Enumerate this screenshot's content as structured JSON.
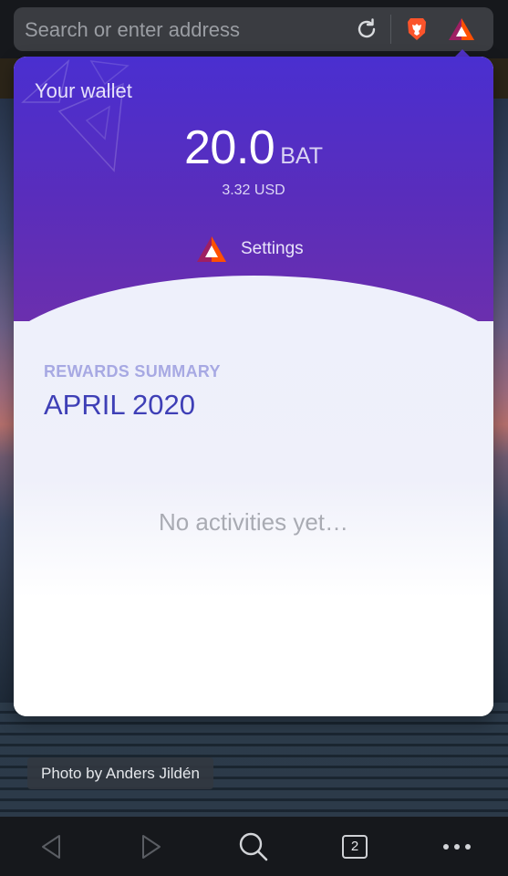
{
  "address_bar": {
    "placeholder": "Search or enter address"
  },
  "icons": {
    "reload": "reload-icon",
    "brave": "brave-lion-icon",
    "rewards": "bat-triangle-icon",
    "back": "back-arrow-icon",
    "forward": "forward-arrow-icon",
    "search": "search-icon",
    "tabs": "tabs-icon",
    "menu": "more-dots-icon"
  },
  "colors": {
    "header_start": "#4a2fd0",
    "header_end": "#6b2fae",
    "summary_label": "#a7a9e3",
    "summary_month": "#3e3fb6",
    "bat_orange": "#ff5000",
    "brave_orange": "#fb542b"
  },
  "wallet": {
    "title": "Your wallet",
    "balance": "20.0",
    "unit": "BAT",
    "usd": "3.32 USD",
    "settings_label": "Settings"
  },
  "summary": {
    "label": "REWARDS SUMMARY",
    "month": "APRIL 2020",
    "empty_message": "No activities yet…"
  },
  "photo_credit": "Photo by Anders Jildén",
  "toolbar": {
    "tab_count": "2"
  }
}
